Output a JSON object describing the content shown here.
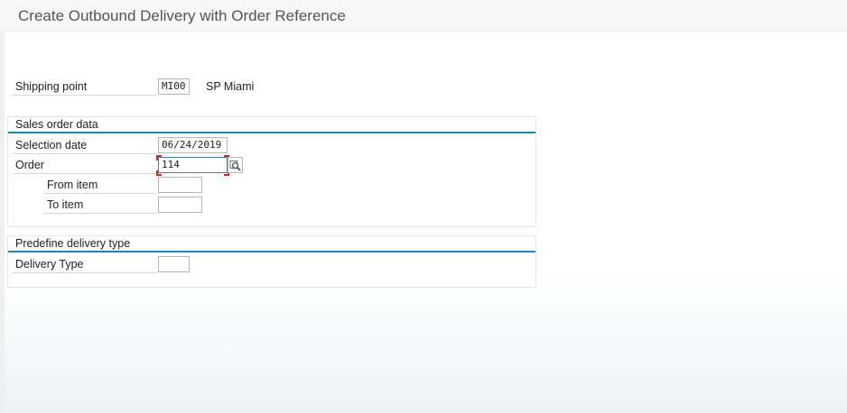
{
  "window": {
    "title": "Create Outbound Delivery with Order Reference"
  },
  "shipping": {
    "label": "Shipping point",
    "value": "MI00",
    "description": "SP Miami"
  },
  "sales_order": {
    "group_title": "Sales order data",
    "selection_date_label": "Selection date",
    "selection_date_value": "06/24/2019",
    "order_label": "Order",
    "order_value": "114",
    "from_item_label": "From item",
    "from_item_value": "",
    "to_item_label": "To item",
    "to_item_value": ""
  },
  "delivery_type": {
    "group_title": "Predefine delivery type",
    "label": "Delivery Type",
    "value": ""
  },
  "icons": {
    "order_search": "search-icon"
  },
  "colors": {
    "group_accent": "#1d88a8",
    "focus_marker": "#d92323"
  }
}
